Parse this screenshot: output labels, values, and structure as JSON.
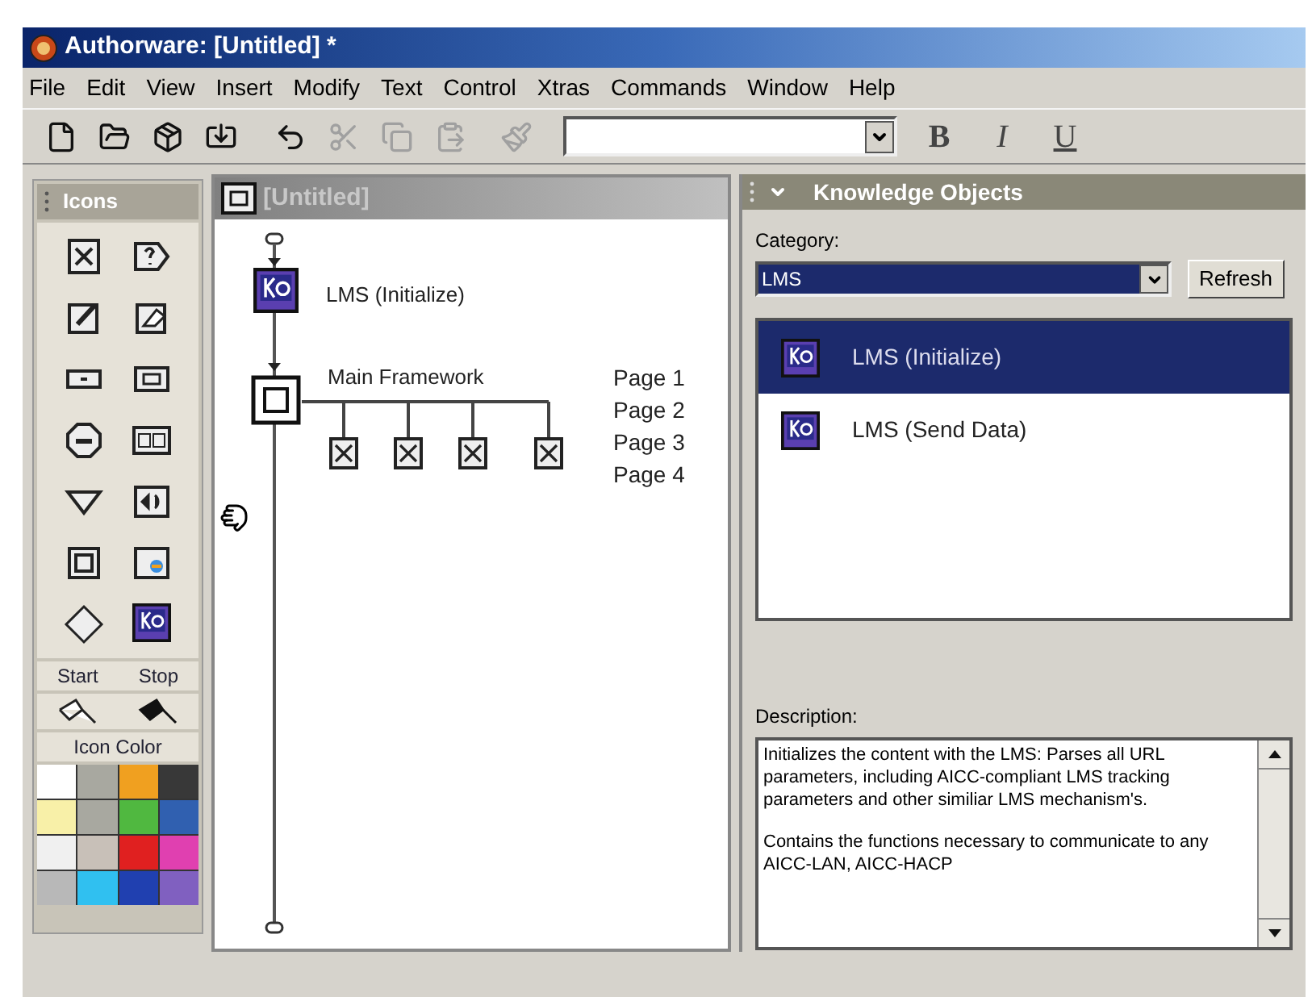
{
  "window": {
    "title": "Authorware: [Untitled] *"
  },
  "menu": [
    "File",
    "Edit",
    "View",
    "Insert",
    "Modify",
    "Text",
    "Control",
    "Xtras",
    "Commands",
    "Window",
    "Help"
  ],
  "toolbar": {
    "tools": [
      {
        "kind": "new",
        "disabled": false
      },
      {
        "kind": "open",
        "disabled": false
      },
      {
        "kind": "save",
        "disabled": false
      },
      {
        "kind": "import",
        "disabled": false
      },
      {
        "kind": "undo",
        "disabled": false
      },
      {
        "kind": "cut",
        "disabled": true
      },
      {
        "kind": "copy",
        "disabled": true
      },
      {
        "kind": "paste",
        "disabled": true
      },
      {
        "kind": "style",
        "disabled": true
      }
    ],
    "styles": [
      {
        "kind": "bold",
        "label": "B"
      },
      {
        "kind": "italic",
        "label": "I"
      },
      {
        "kind": "underline",
        "label": "U"
      }
    ]
  },
  "icons_palette": {
    "title": "Icons",
    "start_label": "Start",
    "stop_label": "Stop",
    "color_label": "Icon Color",
    "swatches": [
      {
        "color": "#ffffff"
      },
      {
        "color": "#a8a8a0"
      },
      {
        "color": "#f0a020"
      },
      {
        "color": "#383838"
      },
      {
        "color": "#f8f0a8"
      },
      {
        "color": "#a8a8a0"
      },
      {
        "color": "#50b840"
      },
      {
        "color": "#3060b0"
      },
      {
        "color": "#f0f0f0"
      },
      {
        "color": "#c8c0b8"
      },
      {
        "color": "#e02020"
      },
      {
        "color": "#e040b0"
      },
      {
        "color": "#b8b8b8"
      },
      {
        "color": "#30c0f0"
      },
      {
        "color": "#2040b0"
      },
      {
        "color": "#8060c0"
      }
    ]
  },
  "flowline": {
    "title": "[Untitled]",
    "ko_label": "LMS (Initialize)",
    "framework_label": "Main Framework",
    "pages": [
      "Page 1",
      "Page 2",
      "Page 3",
      "Page 4"
    ]
  },
  "knowledge_objects": {
    "title": "Knowledge Objects",
    "category_label": "Category:",
    "category_value": "LMS",
    "refresh_button": "Refresh",
    "items": [
      {
        "label": "LMS (Initialize)",
        "selected": true
      },
      {
        "label": "LMS (Send Data)",
        "selected": false
      }
    ],
    "description_label": "Description:",
    "description": [
      "Initializes the content with the LMS:  Parses all URL parameters, including AICC-compliant LMS tracking parameters and other similiar LMS mechanism's.",
      "Contains the functions necessary to communicate to any AICC-LAN, AICC-HACP"
    ]
  }
}
